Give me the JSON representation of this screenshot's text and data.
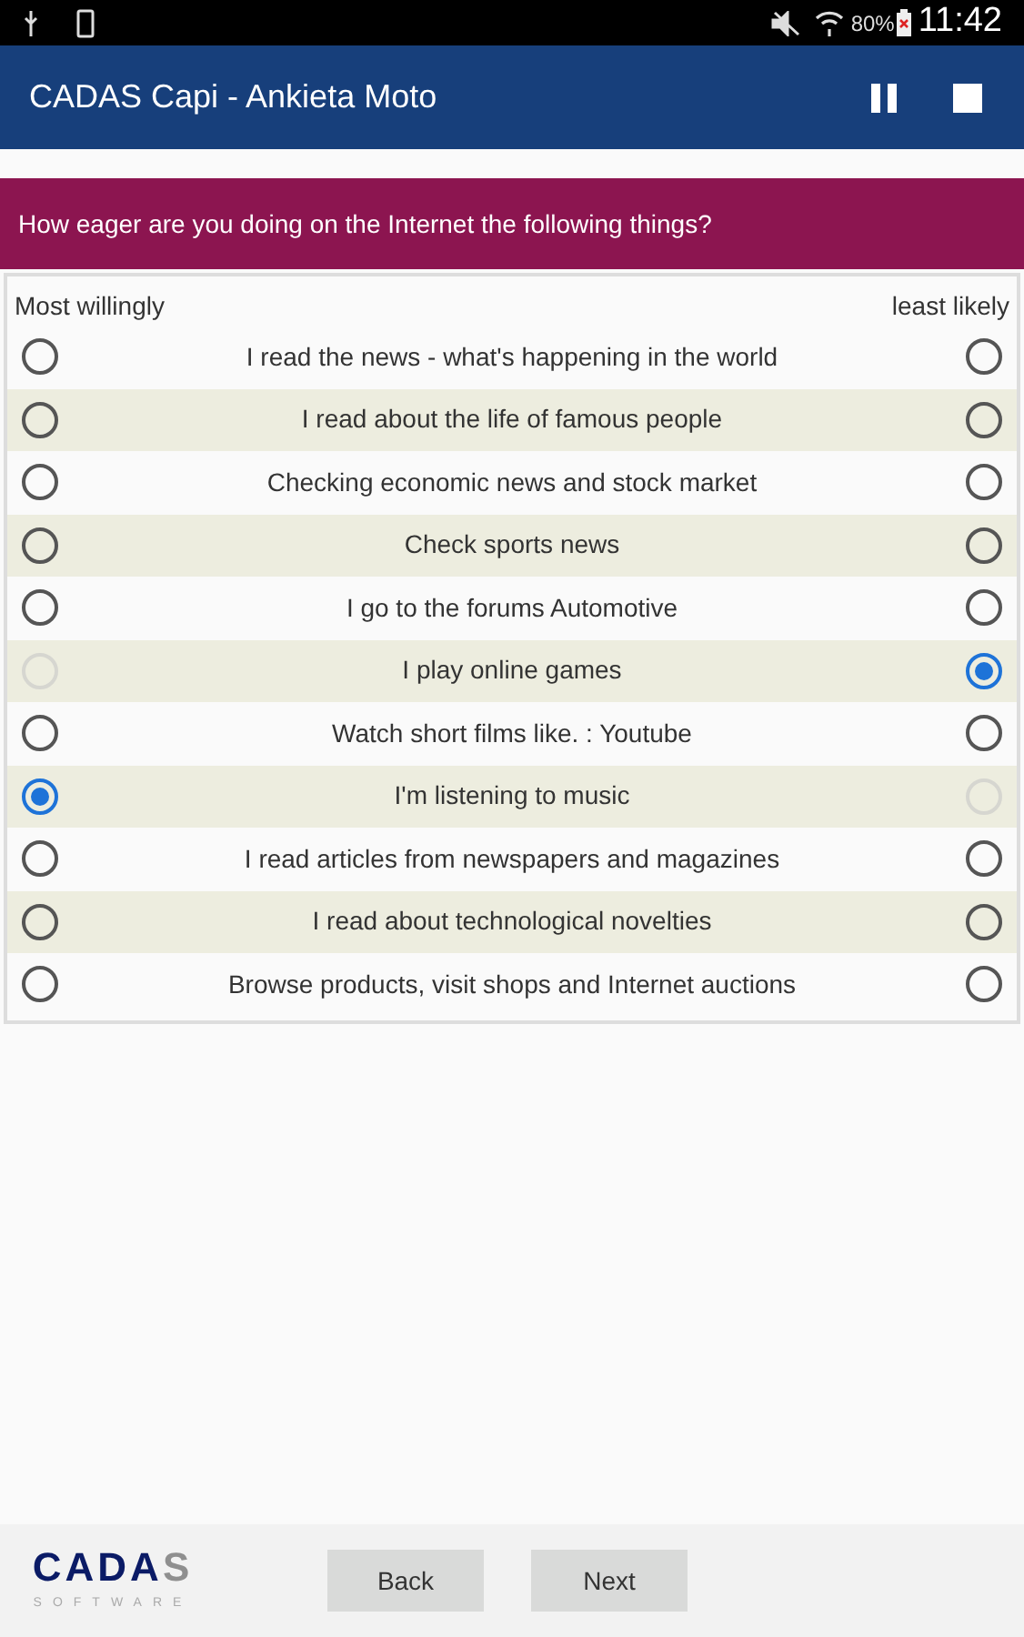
{
  "status_bar": {
    "battery": "80%",
    "time": "11:42"
  },
  "app_bar": {
    "title": "CADAS Capi - Ankieta Moto"
  },
  "question": "How eager are you doing on the Internet the following things?",
  "scale": {
    "left_label": "Most willingly",
    "right_label": "least likely"
  },
  "items": [
    {
      "text": "I read the news - what's happening in the world",
      "left": {
        "selected": false,
        "disabled": false
      },
      "right": {
        "selected": false,
        "disabled": false
      }
    },
    {
      "text": "I read about the life of famous people",
      "left": {
        "selected": false,
        "disabled": false
      },
      "right": {
        "selected": false,
        "disabled": false
      }
    },
    {
      "text": "Checking economic news and stock market",
      "left": {
        "selected": false,
        "disabled": false
      },
      "right": {
        "selected": false,
        "disabled": false
      }
    },
    {
      "text": "Check sports news",
      "left": {
        "selected": false,
        "disabled": false
      },
      "right": {
        "selected": false,
        "disabled": false
      }
    },
    {
      "text": "I go to the forums Automotive",
      "left": {
        "selected": false,
        "disabled": false
      },
      "right": {
        "selected": false,
        "disabled": false
      }
    },
    {
      "text": "I play online games",
      "left": {
        "selected": false,
        "disabled": true
      },
      "right": {
        "selected": true,
        "disabled": false
      }
    },
    {
      "text": "Watch short films like. : Youtube",
      "left": {
        "selected": false,
        "disabled": false
      },
      "right": {
        "selected": false,
        "disabled": false
      }
    },
    {
      "text": "I'm listening to music",
      "left": {
        "selected": true,
        "disabled": false
      },
      "right": {
        "selected": false,
        "disabled": true
      }
    },
    {
      "text": "I read articles from newspapers and magazines",
      "left": {
        "selected": false,
        "disabled": false
      },
      "right": {
        "selected": false,
        "disabled": false
      }
    },
    {
      "text": "I read about technological novelties",
      "left": {
        "selected": false,
        "disabled": false
      },
      "right": {
        "selected": false,
        "disabled": false
      }
    },
    {
      "text": "Browse products, visit shops and Internet auctions",
      "left": {
        "selected": false,
        "disabled": false
      },
      "right": {
        "selected": false,
        "disabled": false
      }
    }
  ],
  "footer": {
    "logo_main": "CADA",
    "logo_accent": "S",
    "logo_sub": "SOFTWARE",
    "buttons": [
      "Back",
      "Next"
    ]
  }
}
